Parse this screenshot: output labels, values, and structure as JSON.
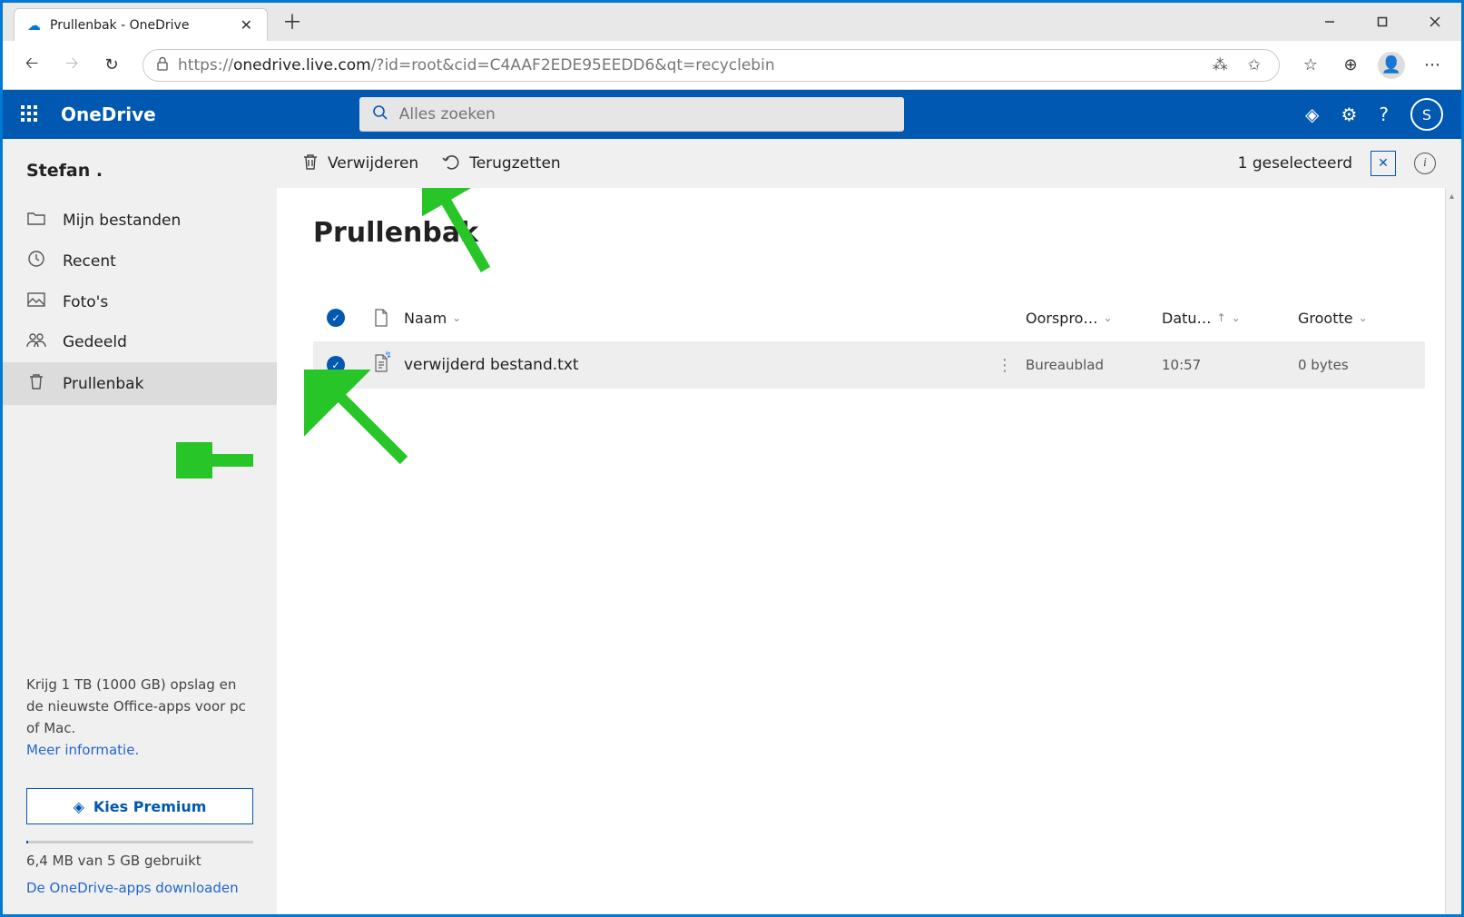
{
  "browser": {
    "tab_title": "Prullenbak - OneDrive",
    "url_prefix": "https://",
    "url_domain": "onedrive.live.com",
    "url_path": "/?id=root&cid=C4AAF2EDE95EEDD6&qt=recyclebin"
  },
  "suite": {
    "brand": "OneDrive",
    "search_placeholder": "Alles zoeken",
    "account_initial": "S"
  },
  "sidebar": {
    "user": "Stefan .",
    "items": [
      {
        "label": "Mijn bestanden",
        "icon": "folder-icon"
      },
      {
        "label": "Recent",
        "icon": "recent-icon"
      },
      {
        "label": "Foto's",
        "icon": "photos-icon"
      },
      {
        "label": "Gedeeld",
        "icon": "shared-icon"
      },
      {
        "label": "Prullenbak",
        "icon": "recycle-icon",
        "active": true
      }
    ],
    "promo_text": "Krijg 1 TB (1000 GB) opslag en de nieuwste Office-apps voor pc of Mac.",
    "promo_link": "Meer informatie.",
    "premium_btn": "Kies Premium",
    "usage_text": "6,4 MB van 5 GB gebruikt",
    "download_apps": "De OneDrive-apps downloaden"
  },
  "toolbar": {
    "delete_label": "Verwijderen",
    "restore_label": "Terugzetten",
    "selection_text": "1 geselecteerd"
  },
  "page": {
    "title": "Prullenbak",
    "columns": {
      "name": "Naam",
      "origin": "Oorspro…",
      "date": "Datu…",
      "size": "Grootte"
    },
    "rows": [
      {
        "selected": true,
        "name": "verwijderd bestand.txt",
        "origin": "Bureaublad",
        "date": "10:57",
        "size": "0 bytes"
      }
    ]
  }
}
